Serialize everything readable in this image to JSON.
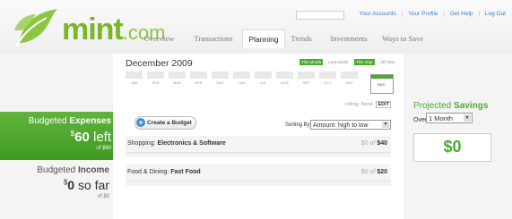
{
  "brand": {
    "logo_main": "mint",
    "logo_suffix": ".com",
    "accent": "#4aab30"
  },
  "top_links": [
    "Your Accounts",
    "Your Profile",
    "Get Help",
    "Log Out"
  ],
  "tabs": [
    {
      "label": "Overview",
      "active": false
    },
    {
      "label": "Transactions",
      "active": false
    },
    {
      "label": "Planning",
      "active": true
    },
    {
      "label": "Trends",
      "active": false
    },
    {
      "label": "Investments",
      "active": false
    },
    {
      "label": "Ways to Save",
      "active": false
    }
  ],
  "sidebar_left": {
    "expenses": {
      "label_pre": "Budgeted ",
      "label_bold": "Expenses",
      "big_prefix": "$",
      "big_value": "60",
      "big_suffix": " left",
      "sub": "of $60"
    },
    "income": {
      "label_pre": "Budgeted ",
      "label_bold": "Income",
      "big_prefix": "$",
      "big_value": "0",
      "big_suffix": " so far",
      "sub": "of $0"
    }
  },
  "planning": {
    "month_title": "December 2009",
    "period_tabs": [
      {
        "label": "This Month",
        "on": true
      },
      {
        "label": "Last Month",
        "on": false
      },
      {
        "label": "This Year",
        "on": true
      },
      {
        "label": "All Time",
        "on": false
      }
    ],
    "months": [
      "JAN",
      "FEB",
      "MAR",
      "APR",
      "MAY",
      "JUN",
      "JUL",
      "AUG",
      "SEP",
      "OCT",
      "NOV",
      "DEC"
    ],
    "rolling_label": "rolling:",
    "rolling_value": "None",
    "rolling_edit": "EDIT",
    "create_budget": "Create a Budget",
    "sort_label": "Sorting By",
    "sort_value": "Amount: high to low",
    "budgets": [
      {
        "category": "Shopping: ",
        "subcategory": "Electronics & Software",
        "spent": "$0",
        "of_word": "of",
        "limit": "$40"
      },
      {
        "category": "Food & Dining: ",
        "subcategory": "Fast Food",
        "spent": "$0",
        "of_word": "of",
        "limit": "$20"
      }
    ]
  },
  "sidebar_right": {
    "proj_label_pre": "Projected ",
    "proj_label_bold": "Savings",
    "over_label": "Over",
    "over_value": "1 Month",
    "savings_value": "$0"
  }
}
